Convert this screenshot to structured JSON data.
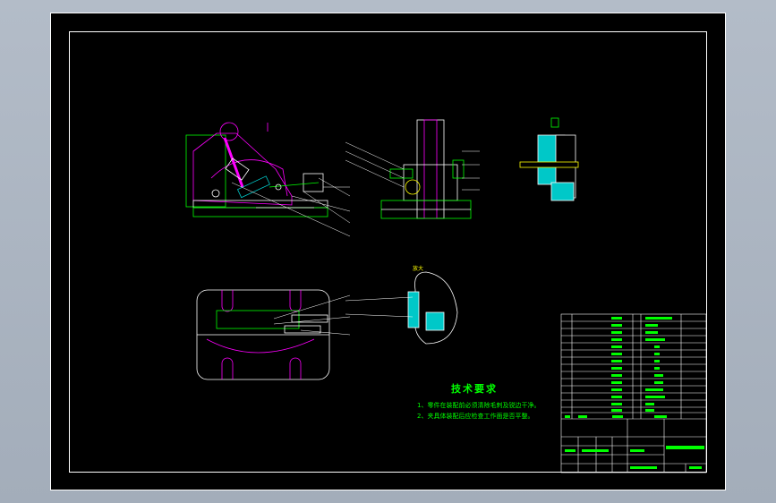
{
  "drawing": {
    "background": "#000000",
    "frame_color": "#ffffff",
    "part_color": "#ff00ff",
    "dimension_color": "#00ff00",
    "section_color": "#00c8c8",
    "tech_requirements": {
      "title": "技术要求",
      "notes": [
        "1、零件在装配前必须清除毛刺及锐边干净。",
        "2、夹具体装配后应检查工作面是否平整。"
      ]
    },
    "detail_label": "放大"
  }
}
